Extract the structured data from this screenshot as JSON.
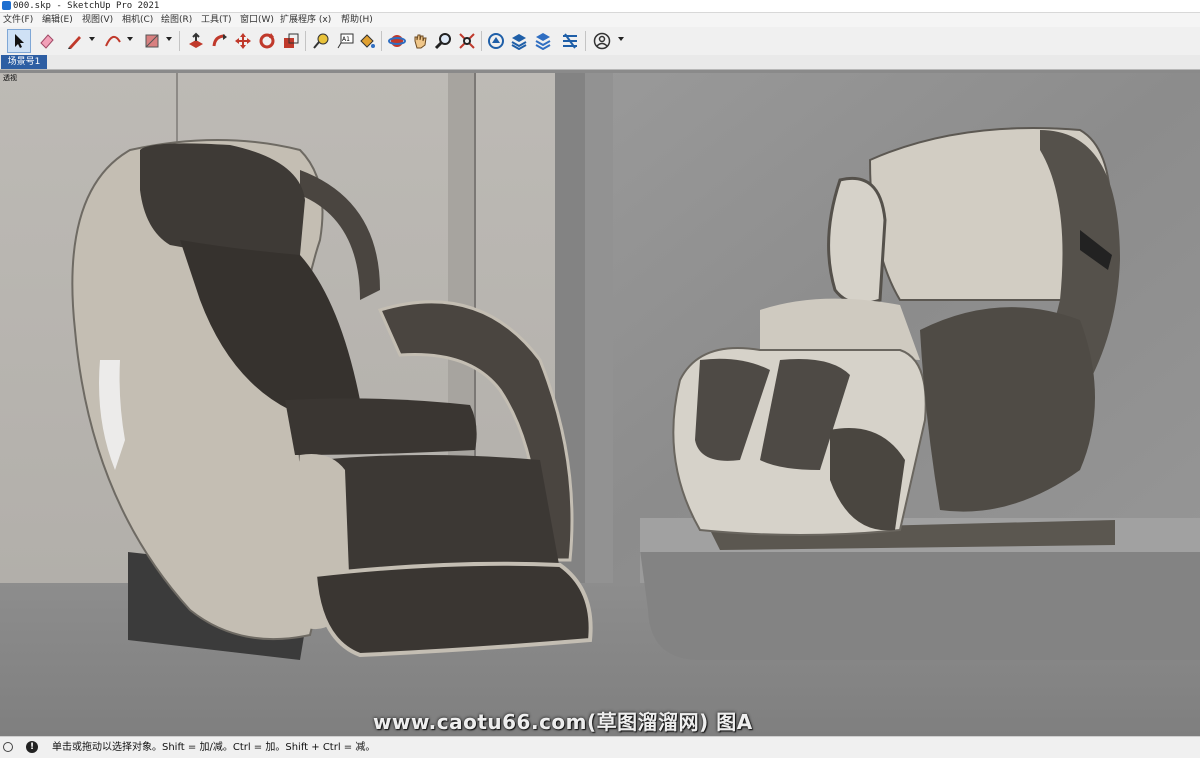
{
  "window": {
    "title": "000.skp - SketchUp Pro 2021"
  },
  "menu": [
    {
      "label": "文件(F)"
    },
    {
      "label": "编辑(E)"
    },
    {
      "label": "视图(V)"
    },
    {
      "label": "相机(C)"
    },
    {
      "label": "绘图(R)"
    },
    {
      "label": "工具(T)"
    },
    {
      "label": "窗口(W)"
    },
    {
      "label": "扩展程序 (x)"
    },
    {
      "label": "帮助(H)"
    }
  ],
  "toolbar": {
    "tools": [
      {
        "icon": "select-arrow-icon",
        "active": true
      },
      {
        "icon": "eraser-icon"
      },
      {
        "icon": "pencil-line-icon"
      },
      {
        "icon": "arc-icon"
      },
      {
        "icon": "rectangle-shape-icon"
      },
      {
        "icon": "push-pull-icon"
      },
      {
        "icon": "follow-me-icon"
      },
      {
        "icon": "move-icon"
      },
      {
        "icon": "rotate-icon"
      },
      {
        "icon": "scale-icon"
      },
      {
        "icon": "tape-measure-icon"
      },
      {
        "icon": "text-icon",
        "text": "A1"
      },
      {
        "icon": "paint-bucket-icon"
      },
      {
        "icon": "orbit-icon"
      },
      {
        "icon": "pan-hand-icon"
      },
      {
        "icon": "zoom-icon"
      },
      {
        "icon": "zoom-extents-icon"
      },
      {
        "icon": "warehouse-icon"
      },
      {
        "icon": "extension-warehouse-icon"
      },
      {
        "icon": "layers-stack-icon"
      },
      {
        "icon": "extension-manager-icon"
      },
      {
        "icon": "account-icon"
      }
    ]
  },
  "scene": {
    "tab_label": "场景号1",
    "view_label": "透视"
  },
  "watermark": "www.caotu66.com(草图溜溜网) 图A",
  "status": {
    "text": "单击或拖动以选择对象。Shift = 加/减。Ctrl = 加。Shift + Ctrl = 减。"
  },
  "colors": {
    "accent": "#2d5ea3",
    "upholstery_dark": "#3e3a36",
    "shell_light": "#c4beb3",
    "cream": "#d6d2c9",
    "wall": "#b9b6b1",
    "concrete": "#8f8f8f",
    "floor": "#888888"
  }
}
